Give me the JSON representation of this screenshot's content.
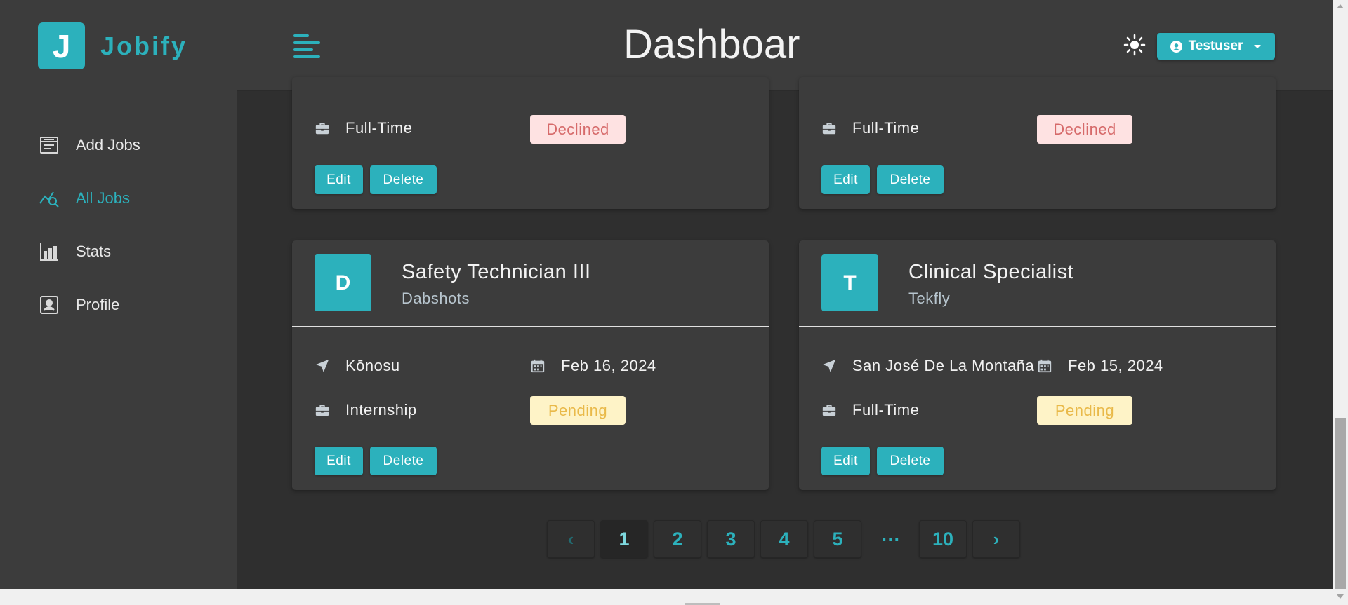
{
  "app": {
    "logo_letter": "J",
    "name": "Jobify"
  },
  "header": {
    "title": "Dashboar",
    "user_label": "Testuser"
  },
  "sidebar": {
    "items": [
      {
        "label": "Add Jobs",
        "icon": "add-jobs-icon",
        "active": false
      },
      {
        "label": "All Jobs",
        "icon": "all-jobs-icon",
        "active": true
      },
      {
        "label": "Stats",
        "icon": "stats-icon",
        "active": false
      },
      {
        "label": "Profile",
        "icon": "profile-icon",
        "active": false
      }
    ]
  },
  "jobs": [
    {
      "job_type": "Full-Time",
      "status": "Declined",
      "edit_label": "Edit",
      "delete_label": "Delete"
    },
    {
      "job_type": "Full-Time",
      "status": "Declined",
      "edit_label": "Edit",
      "delete_label": "Delete"
    },
    {
      "avatar": "D",
      "title": "Safety Technician III",
      "company": "Dabshots",
      "location": "Kōnosu",
      "date": "Feb 16, 2024",
      "job_type": "Internship",
      "status": "Pending",
      "edit_label": "Edit",
      "delete_label": "Delete"
    },
    {
      "avatar": "T",
      "title": "Clinical Specialist",
      "company": "Tekfly",
      "location": "San José De La Montaña",
      "date": "Feb 15, 2024",
      "job_type": "Full-Time",
      "status": "Pending",
      "edit_label": "Edit",
      "delete_label": "Delete"
    }
  ],
  "pagination": {
    "prev": "‹",
    "pages": [
      "1",
      "2",
      "3",
      "4",
      "5"
    ],
    "ellipsis": "···",
    "last": "10",
    "next": "›",
    "current": "1"
  },
  "colors": {
    "accent": "#2cb1bc",
    "background": "#2f2f2f",
    "panel": "#3c3c3c",
    "declined_bg": "#fee2e2",
    "declined_text": "#d66a6a",
    "pending_bg": "#fef3c7",
    "pending_text": "#e9b949"
  }
}
